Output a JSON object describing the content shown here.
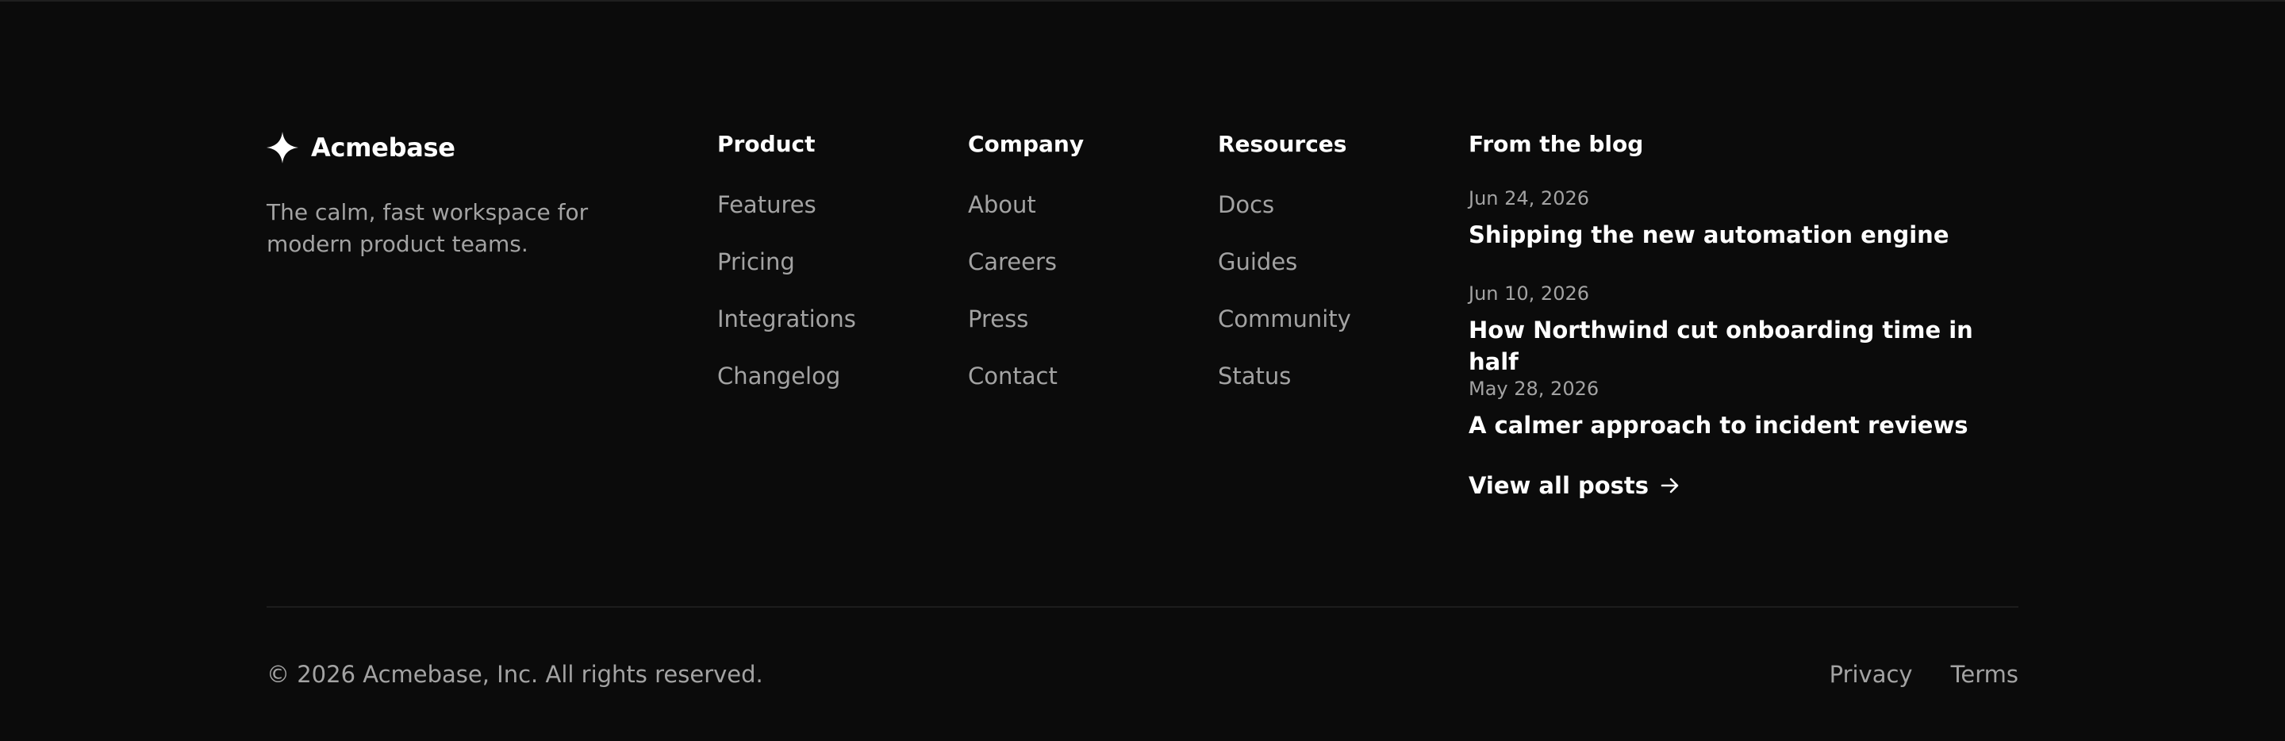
{
  "brand": {
    "icon": "sparkle-icon",
    "name": "Acmebase",
    "tagline": "The calm, fast workspace for modern product teams."
  },
  "columns": {
    "product": {
      "heading": "Product",
      "links": [
        "Features",
        "Pricing",
        "Integrations",
        "Changelog"
      ]
    },
    "company": {
      "heading": "Company",
      "links": [
        "About",
        "Careers",
        "Press",
        "Contact"
      ]
    },
    "resources": {
      "heading": "Resources",
      "links": [
        "Docs",
        "Guides",
        "Community",
        "Status"
      ]
    }
  },
  "blog": {
    "heading": "From the blog",
    "posts": [
      {
        "date": "Jun 24, 2026",
        "title": "Shipping the new automation engine"
      },
      {
        "date": "Jun 10, 2026",
        "title": "How Northwind cut onboarding time in half"
      },
      {
        "date": "May 28, 2026",
        "title": "A calmer approach to incident reviews"
      }
    ],
    "view_all_label": "View all posts",
    "view_all_icon": "arrow-right-icon"
  },
  "bottom": {
    "copyright": "© 2026 Acmebase, Inc. All rights reserved.",
    "legal_links": [
      "Privacy",
      "Terms"
    ]
  },
  "colors": {
    "background": "#0b0b0b",
    "text_primary": "#ffffff",
    "text_muted": "#a3a3a3",
    "divider": "#1c1c1c"
  }
}
